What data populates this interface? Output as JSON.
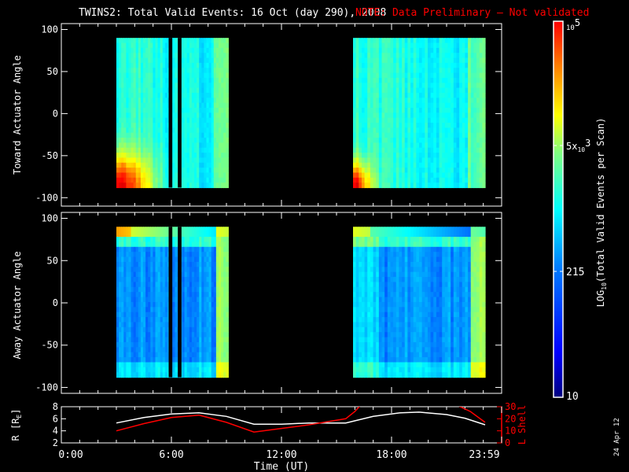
{
  "chart_data": {
    "type": "heatmap",
    "title": "TWINS2: Total Valid Events: 16 Oct (day 290), 2008",
    "note": "NOTE: Data Preliminary — Not validated",
    "note_color": "#ff0000",
    "date_stamp": "24 Apr 12",
    "xlabel": "Time (UT)",
    "x_ticks": [
      "0:00",
      "6:00",
      "12:00",
      "18:00",
      "23:59"
    ],
    "x_tick_hours": [
      0,
      6,
      12,
      18,
      24
    ],
    "xlim_hours": [
      0,
      24
    ],
    "panels": [
      {
        "ylabel": "Toward Actuator Angle",
        "ylim": [
          -110,
          107
        ],
        "y_ticks": [
          "100",
          "50",
          "0",
          "-50",
          "-100"
        ],
        "y_tick_values": [
          100,
          50,
          0,
          -50,
          -100
        ],
        "data_range_deg": [
          -88,
          90
        ],
        "blocks_hours": [
          [
            3.0,
            9.1
          ],
          [
            15.9,
            23.1
          ]
        ],
        "gaps_hours": [
          [
            5.85,
            6.05
          ],
          [
            6.35,
            6.55
          ]
        ]
      },
      {
        "ylabel": "Away Actuator Angle",
        "ylim": [
          -107,
          107
        ],
        "y_ticks": [
          "100",
          "50",
          "0",
          "-50",
          "-100"
        ],
        "y_tick_values": [
          100,
          50,
          0,
          -50,
          -100
        ],
        "data_range_deg": [
          -88,
          90
        ],
        "blocks_hours": [
          [
            3.0,
            9.1
          ],
          [
            15.9,
            23.1
          ]
        ],
        "gaps_hours": [
          [
            5.85,
            6.05
          ],
          [
            6.35,
            6.55
          ]
        ]
      }
    ],
    "colorbar": {
      "label": "LOG10(Total Valid Events per Scan)",
      "label_main": "LOG",
      "label_sub": "10",
      "label_rest": "(Total Valid Events per Scan)",
      "range": [
        10,
        100000
      ],
      "ticks": [
        {
          "value": 100000,
          "base": "10",
          "exp": "5",
          "prefix": ""
        },
        {
          "value": 5000,
          "base": "10",
          "exp": "3",
          "prefix": "5x"
        },
        {
          "value": 215,
          "text": "215"
        },
        {
          "value": 10,
          "text": "10"
        }
      ]
    },
    "orbit_panel": {
      "left_label": "R [R",
      "left_label_sub": "E",
      "left_label_end": "]",
      "left_ylim": [
        2,
        8
      ],
      "left_ticks": [
        "2",
        "4",
        "6",
        "8"
      ],
      "left_tick_values": [
        2,
        4,
        6,
        8
      ],
      "right_label": "L Shell",
      "right_ylim": [
        0,
        30
      ],
      "right_ticks": [
        "0",
        "10",
        "20",
        "30"
      ],
      "right_tick_values": [
        0,
        10,
        20,
        30
      ],
      "right_color": "#ff0000",
      "series": [
        {
          "name": "R",
          "color": "#ffffff",
          "axis": "left",
          "x": [
            3.0,
            4.5,
            6.0,
            7.5,
            9.0,
            10.5,
            12.0,
            13.5,
            15.5,
            17.0,
            18.5,
            19.5,
            21.0,
            22.0,
            23.1
          ],
          "y": [
            5.3,
            6.2,
            6.8,
            7.0,
            6.4,
            5.1,
            5.1,
            5.3,
            5.3,
            6.4,
            7.0,
            7.1,
            6.7,
            6.1,
            5.0
          ]
        },
        {
          "name": "L Shell",
          "color": "#ff0000",
          "axis": "right",
          "x": [
            3.0,
            4.5,
            6.0,
            7.5,
            9.0,
            10.5,
            12.0,
            13.5,
            15.5,
            16.0,
            16.3
          ],
          "y": [
            10,
            16,
            21,
            23,
            17,
            9,
            12,
            15,
            20,
            26,
            31
          ]
        },
        {
          "name": "L Shell (late)",
          "color": "#ff0000",
          "axis": "right",
          "x": [
            21.6,
            22.3,
            23.1
          ],
          "y": [
            31,
            26,
            17
          ]
        }
      ]
    }
  }
}
